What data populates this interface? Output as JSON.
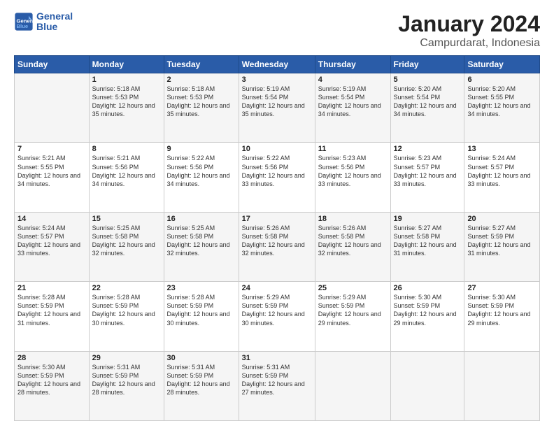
{
  "logo": {
    "line1": "General",
    "line2": "Blue"
  },
  "title": "January 2024",
  "subtitle": "Campurdarat, Indonesia",
  "days_header": [
    "Sunday",
    "Monday",
    "Tuesday",
    "Wednesday",
    "Thursday",
    "Friday",
    "Saturday"
  ],
  "weeks": [
    [
      {
        "day": "",
        "info": ""
      },
      {
        "day": "1",
        "info": "Sunrise: 5:18 AM\nSunset: 5:53 PM\nDaylight: 12 hours\nand 35 minutes."
      },
      {
        "day": "2",
        "info": "Sunrise: 5:18 AM\nSunset: 5:53 PM\nDaylight: 12 hours\nand 35 minutes."
      },
      {
        "day": "3",
        "info": "Sunrise: 5:19 AM\nSunset: 5:54 PM\nDaylight: 12 hours\nand 35 minutes."
      },
      {
        "day": "4",
        "info": "Sunrise: 5:19 AM\nSunset: 5:54 PM\nDaylight: 12 hours\nand 34 minutes."
      },
      {
        "day": "5",
        "info": "Sunrise: 5:20 AM\nSunset: 5:54 PM\nDaylight: 12 hours\nand 34 minutes."
      },
      {
        "day": "6",
        "info": "Sunrise: 5:20 AM\nSunset: 5:55 PM\nDaylight: 12 hours\nand 34 minutes."
      }
    ],
    [
      {
        "day": "7",
        "info": "Sunrise: 5:21 AM\nSunset: 5:55 PM\nDaylight: 12 hours\nand 34 minutes."
      },
      {
        "day": "8",
        "info": "Sunrise: 5:21 AM\nSunset: 5:56 PM\nDaylight: 12 hours\nand 34 minutes."
      },
      {
        "day": "9",
        "info": "Sunrise: 5:22 AM\nSunset: 5:56 PM\nDaylight: 12 hours\nand 34 minutes."
      },
      {
        "day": "10",
        "info": "Sunrise: 5:22 AM\nSunset: 5:56 PM\nDaylight: 12 hours\nand 33 minutes."
      },
      {
        "day": "11",
        "info": "Sunrise: 5:23 AM\nSunset: 5:56 PM\nDaylight: 12 hours\nand 33 minutes."
      },
      {
        "day": "12",
        "info": "Sunrise: 5:23 AM\nSunset: 5:57 PM\nDaylight: 12 hours\nand 33 minutes."
      },
      {
        "day": "13",
        "info": "Sunrise: 5:24 AM\nSunset: 5:57 PM\nDaylight: 12 hours\nand 33 minutes."
      }
    ],
    [
      {
        "day": "14",
        "info": "Sunrise: 5:24 AM\nSunset: 5:57 PM\nDaylight: 12 hours\nand 33 minutes."
      },
      {
        "day": "15",
        "info": "Sunrise: 5:25 AM\nSunset: 5:58 PM\nDaylight: 12 hours\nand 32 minutes."
      },
      {
        "day": "16",
        "info": "Sunrise: 5:25 AM\nSunset: 5:58 PM\nDaylight: 12 hours\nand 32 minutes."
      },
      {
        "day": "17",
        "info": "Sunrise: 5:26 AM\nSunset: 5:58 PM\nDaylight: 12 hours\nand 32 minutes."
      },
      {
        "day": "18",
        "info": "Sunrise: 5:26 AM\nSunset: 5:58 PM\nDaylight: 12 hours\nand 32 minutes."
      },
      {
        "day": "19",
        "info": "Sunrise: 5:27 AM\nSunset: 5:58 PM\nDaylight: 12 hours\nand 31 minutes."
      },
      {
        "day": "20",
        "info": "Sunrise: 5:27 AM\nSunset: 5:59 PM\nDaylight: 12 hours\nand 31 minutes."
      }
    ],
    [
      {
        "day": "21",
        "info": "Sunrise: 5:28 AM\nSunset: 5:59 PM\nDaylight: 12 hours\nand 31 minutes."
      },
      {
        "day": "22",
        "info": "Sunrise: 5:28 AM\nSunset: 5:59 PM\nDaylight: 12 hours\nand 30 minutes."
      },
      {
        "day": "23",
        "info": "Sunrise: 5:28 AM\nSunset: 5:59 PM\nDaylight: 12 hours\nand 30 minutes."
      },
      {
        "day": "24",
        "info": "Sunrise: 5:29 AM\nSunset: 5:59 PM\nDaylight: 12 hours\nand 30 minutes."
      },
      {
        "day": "25",
        "info": "Sunrise: 5:29 AM\nSunset: 5:59 PM\nDaylight: 12 hours\nand 29 minutes."
      },
      {
        "day": "26",
        "info": "Sunrise: 5:30 AM\nSunset: 5:59 PM\nDaylight: 12 hours\nand 29 minutes."
      },
      {
        "day": "27",
        "info": "Sunrise: 5:30 AM\nSunset: 5:59 PM\nDaylight: 12 hours\nand 29 minutes."
      }
    ],
    [
      {
        "day": "28",
        "info": "Sunrise: 5:30 AM\nSunset: 5:59 PM\nDaylight: 12 hours\nand 28 minutes."
      },
      {
        "day": "29",
        "info": "Sunrise: 5:31 AM\nSunset: 5:59 PM\nDaylight: 12 hours\nand 28 minutes."
      },
      {
        "day": "30",
        "info": "Sunrise: 5:31 AM\nSunset: 5:59 PM\nDaylight: 12 hours\nand 28 minutes."
      },
      {
        "day": "31",
        "info": "Sunrise: 5:31 AM\nSunset: 5:59 PM\nDaylight: 12 hours\nand 27 minutes."
      },
      {
        "day": "",
        "info": ""
      },
      {
        "day": "",
        "info": ""
      },
      {
        "day": "",
        "info": ""
      }
    ]
  ]
}
